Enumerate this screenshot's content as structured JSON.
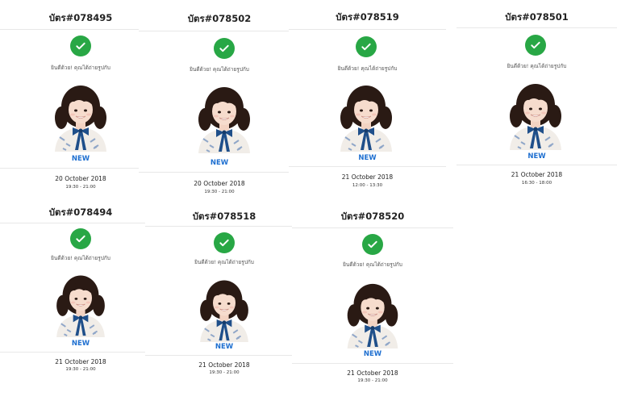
{
  "cards": [
    {
      "title": "บัตร#078495",
      "congrats": "ยินดีด้วย! คุณได้ถ่ายรูปกับ",
      "status": "NEW",
      "date": "20 October 2018",
      "time": "19:30 - 21:00"
    },
    {
      "title": "บัตร#078502",
      "congrats": "ยินดีด้วย! คุณได้ถ่ายรูปกับ",
      "status": "NEW",
      "date": "20 October 2018",
      "time": "19:30 - 21:00"
    },
    {
      "title": "บัตร#078519",
      "congrats": "ยินดีด้วย! คุณได้ถ่ายรูปกับ",
      "status": "NEW",
      "date": "21 October 2018",
      "time": "12:00 - 13:30"
    },
    {
      "title": "บัตร#078501",
      "congrats": "ยินดีด้วย! คุณได้ถ่ายรูปกับ",
      "status": "NEW",
      "date": "21 October 2018",
      "time": "16:30 - 18:00"
    },
    {
      "title": "บัตร#078494",
      "congrats": "ยินดีด้วย! คุณได้ถ่ายรูปกับ",
      "status": "NEW",
      "date": "21 October 2018",
      "time": "19:30 - 21:00"
    },
    {
      "title": "บัตร#078518",
      "congrats": "ยินดีด้วย! คุณได้ถ่ายรูปกับ",
      "status": "NEW",
      "date": "21 October 2018",
      "time": "19:30 - 21:00"
    },
    {
      "title": "บัตร#078520",
      "congrats": "ยินดีด้วย! คุณได้ถ่ายรูปกับ",
      "status": "NEW",
      "date": "21 October 2018",
      "time": "19:30 - 21:00"
    }
  ],
  "icons": {
    "status": "check-circle-icon"
  },
  "colors": {
    "check": "#28a745",
    "new_label": "#1e6fd0"
  }
}
